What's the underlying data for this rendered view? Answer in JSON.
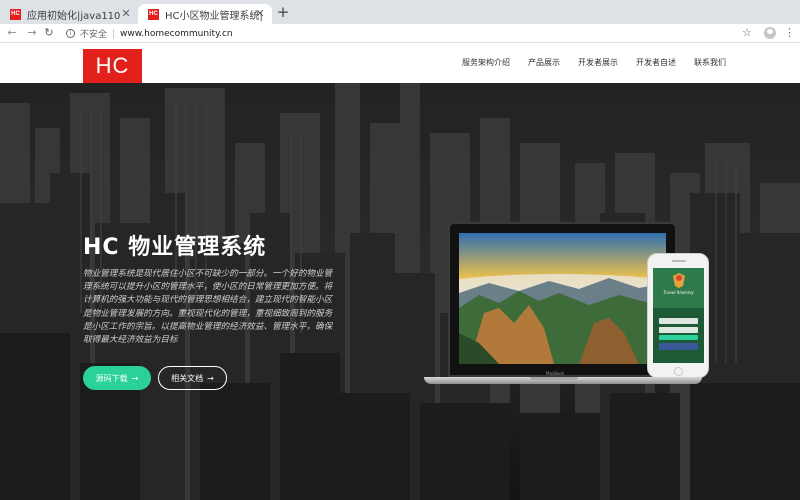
{
  "browser": {
    "tabs": [
      {
        "favicon": "HC",
        "title": "应用初始化|java110",
        "active": false
      },
      {
        "favicon": "HC",
        "title": "HC小区物业管理系统|免费开源",
        "active": true
      }
    ],
    "address": {
      "security_label": "不安全",
      "url": "www.homecommunity.cn"
    }
  },
  "site": {
    "logo": "HC",
    "nav": [
      "服务架构介绍",
      "产品展示",
      "开发者展示",
      "开发者自述",
      "联系我们"
    ]
  },
  "hero": {
    "title": "HC 物业管理系统",
    "description": "物业管理系统是现代居住小区不可缺少的一部分。一个好的物业管理系统可以提升小区的管理水平，使小区的日常管理更加方便。将计算机的强大功能与现代的管理思想相结合，建立现代的智能小区是物业管理发展的方向。重视现代化的管理，重视细致周到的服务是小区工作的宗旨。以提高物业管理的经济效益、管理水平，确保取得最大经济效益为目标",
    "download_button": "源码下载",
    "docs_button": "相关文档",
    "laptop_brand": "MacBook",
    "phone_app_title": "Travel Itinerary"
  },
  "colors": {
    "brand_red": "#e4201d",
    "accent_green": "#2bd19a"
  },
  "icons": {
    "back": "arrow-left-icon",
    "forward": "arrow-right-icon",
    "reload": "reload-icon",
    "info": "info-icon",
    "bookmark": "star-icon",
    "profile": "avatar-icon",
    "menu": "kebab-menu-icon"
  }
}
